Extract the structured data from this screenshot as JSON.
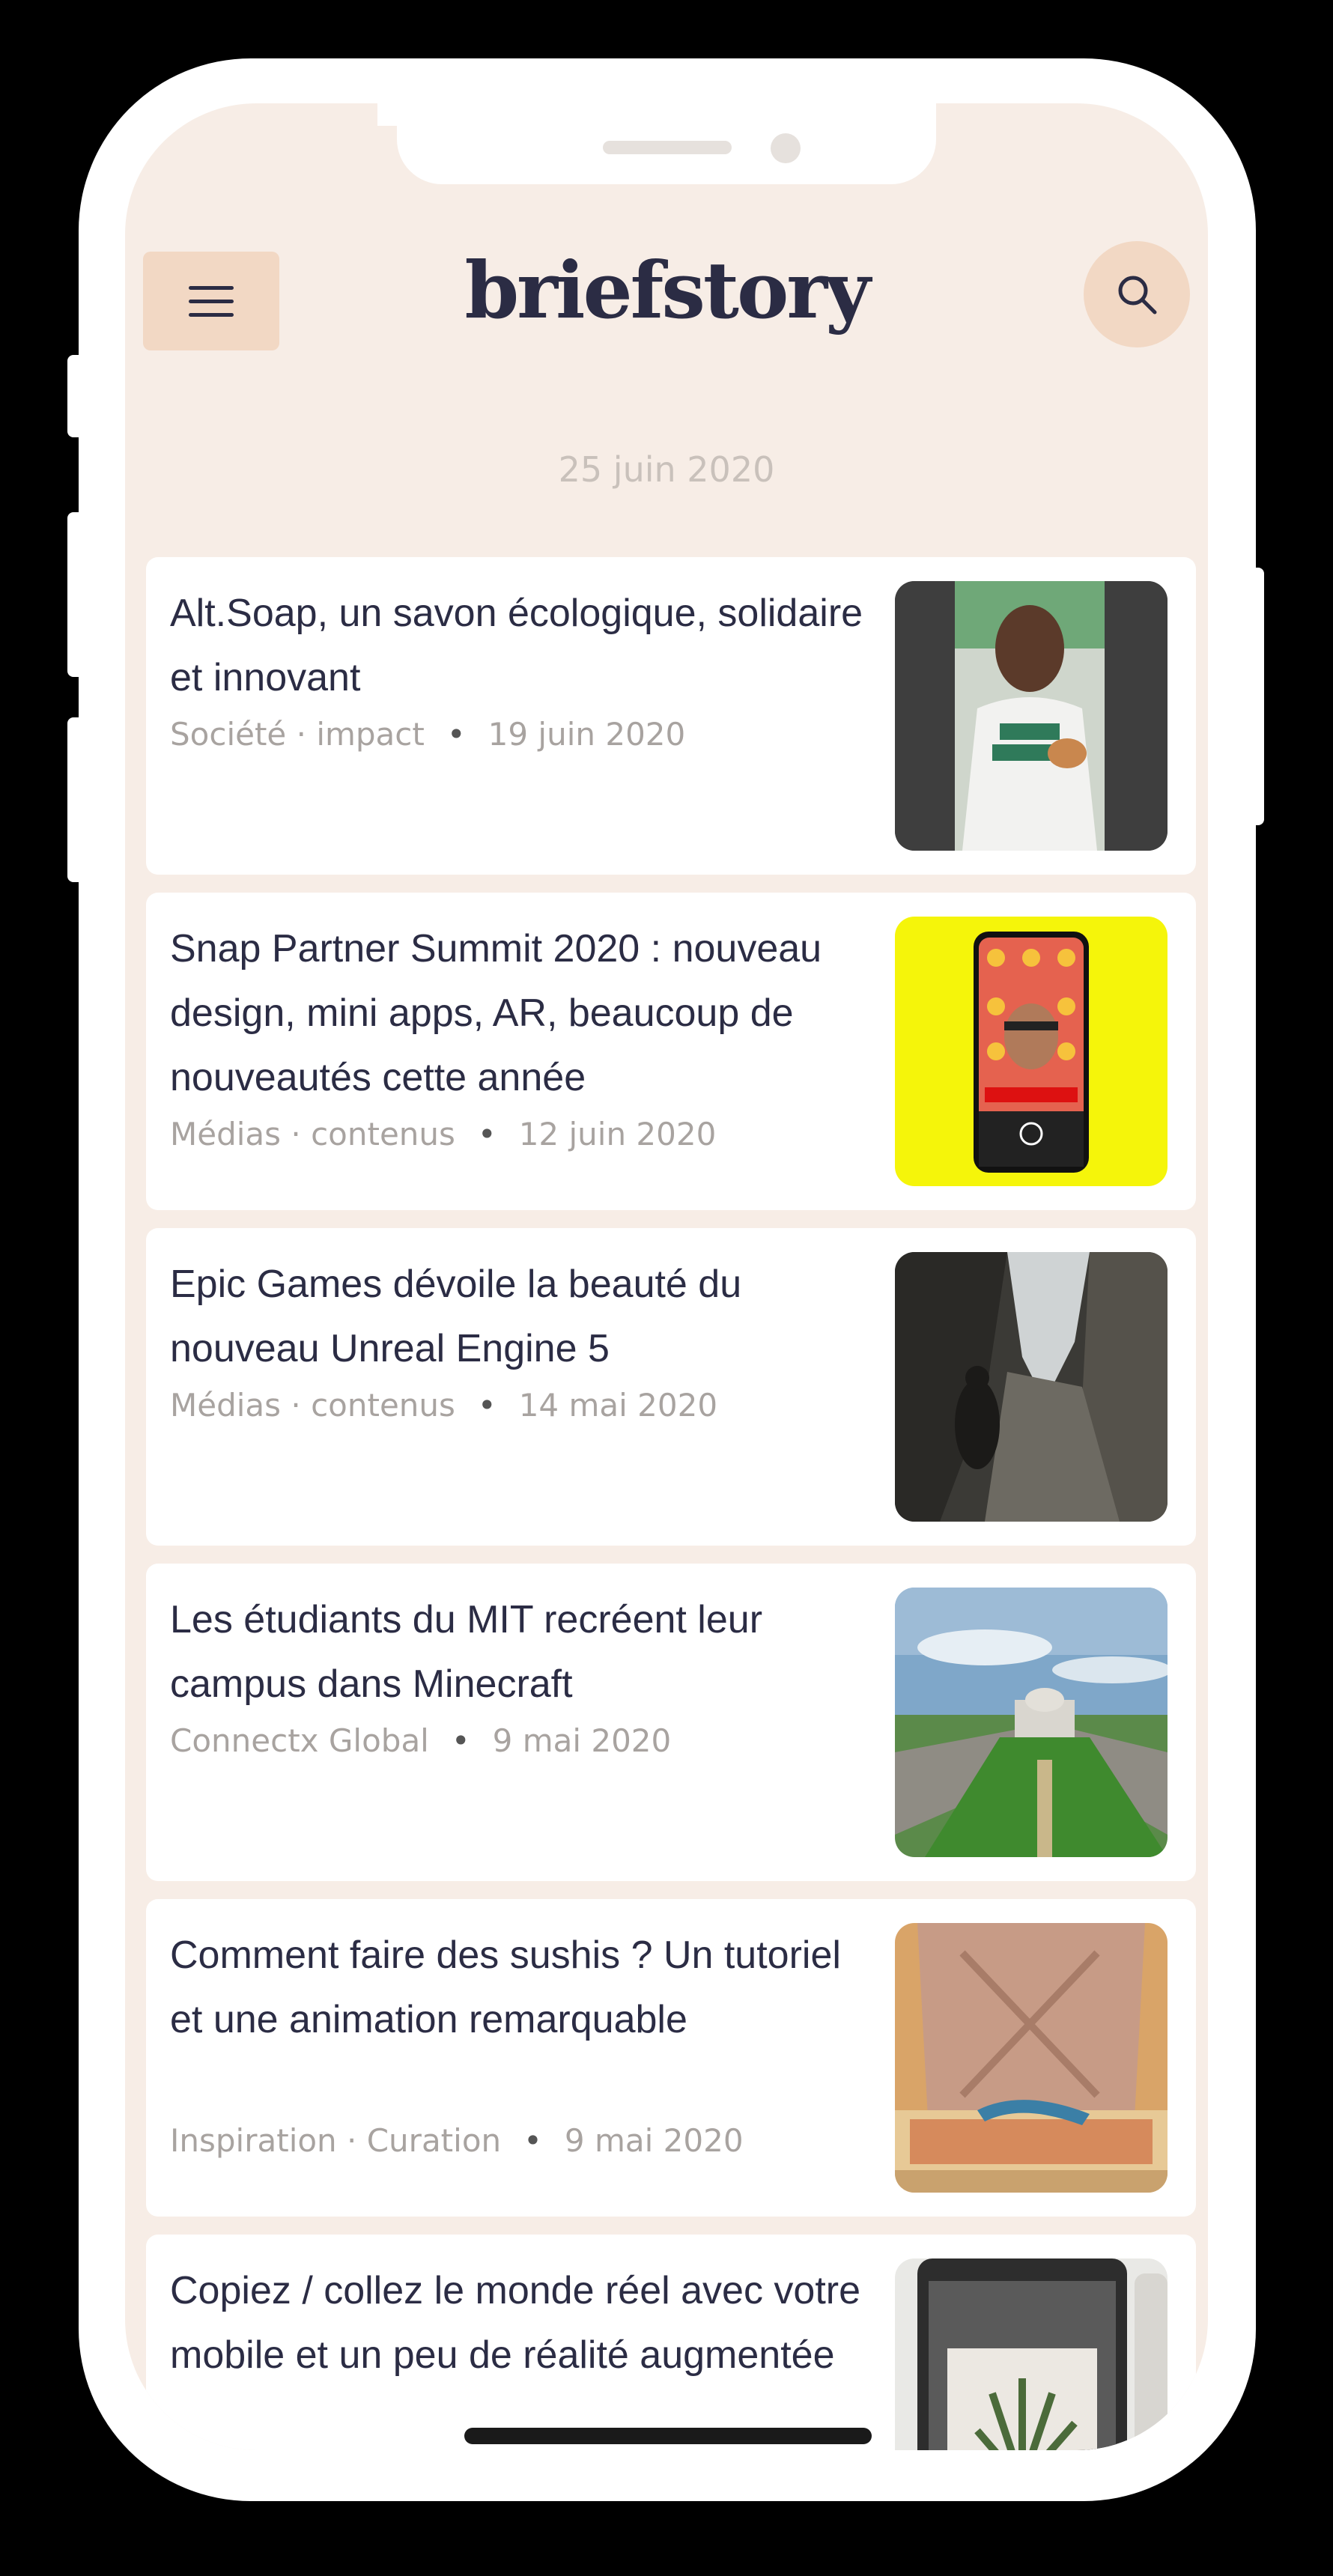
{
  "app": {
    "brand": "briefstory",
    "menu_icon": "hamburger-menu-icon",
    "search_icon": "search-icon",
    "date_heading": "25 juin 2020"
  },
  "colors": {
    "background": "#f7ede6",
    "accent": "#f2d8c4",
    "text_dark": "#2b2c44",
    "text_muted": "#a8a3a0"
  },
  "articles": [
    {
      "title": "Alt.Soap, un savon écologique, solidaire et innovant",
      "category": "Société · impact",
      "date": "19 juin 2020",
      "image": "woman-holding-soap-thumbnail"
    },
    {
      "title": "Snap Partner Summit 2020 : nouveau design, mini apps, AR, beaucoup de nouveautés cette année",
      "category": "Médias · contenus",
      "date": "12 juin 2020",
      "image": "snapchat-phone-thumbnail"
    },
    {
      "title": "Epic Games dévoile la beauté du nouveau Unreal Engine 5",
      "category": "Médias · contenus",
      "date": "14 mai 2020",
      "image": "unreal-engine-cave-thumbnail"
    },
    {
      "title": "Les étudiants du MIT recréent leur campus dans Minecraft",
      "category": "Connectx Global",
      "date": "9 mai 2020",
      "image": "minecraft-mit-campus-thumbnail"
    },
    {
      "title": "Comment faire des sushis ? Un tutoriel et une animation remarquable",
      "category": "Inspiration · Curation",
      "date": "9 mai 2020",
      "image": "sushi-animation-thumbnail"
    },
    {
      "title": "Copiez / collez le monde réel avec votre mobile et un peu de réalité augmentée",
      "category": "",
      "date": "",
      "image": "ar-copy-paste-thumbnail"
    }
  ]
}
